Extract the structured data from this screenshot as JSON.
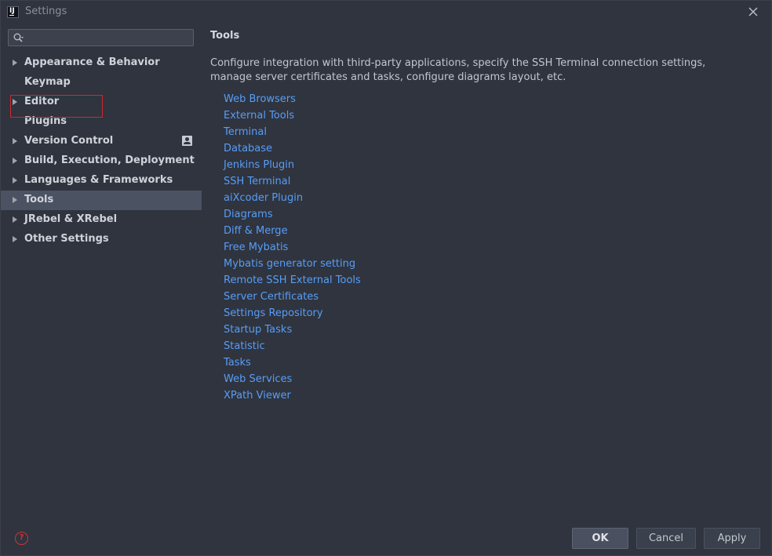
{
  "window": {
    "title": "Settings"
  },
  "search": {
    "value": "",
    "placeholder": ""
  },
  "sidebar": {
    "items": [
      {
        "label": "Appearance & Behavior",
        "expandable": true,
        "selected": false
      },
      {
        "label": "Keymap",
        "expandable": false,
        "selected": false,
        "highlighted": true
      },
      {
        "label": "Editor",
        "expandable": true,
        "selected": false
      },
      {
        "label": "Plugins",
        "expandable": false,
        "selected": false
      },
      {
        "label": "Version Control",
        "expandable": true,
        "selected": false,
        "badge_icon": "project-profile-icon"
      },
      {
        "label": "Build, Execution, Deployment",
        "expandable": true,
        "selected": false
      },
      {
        "label": "Languages & Frameworks",
        "expandable": true,
        "selected": false
      },
      {
        "label": "Tools",
        "expandable": true,
        "selected": true
      },
      {
        "label": "JRebel & XRebel",
        "expandable": true,
        "selected": false
      },
      {
        "label": "Other Settings",
        "expandable": true,
        "selected": false
      }
    ]
  },
  "content": {
    "title": "Tools",
    "description": "Configure integration with third-party applications, specify the SSH Terminal connection settings, manage server certificates and tasks, configure diagrams layout, etc.",
    "links": [
      "Web Browsers",
      "External Tools",
      "Terminal",
      "Database",
      "Jenkins Plugin",
      "SSH Terminal",
      "aiXcoder Plugin",
      "Diagrams",
      "Diff & Merge",
      "Free Mybatis",
      "Mybatis generator setting",
      "Remote SSH External Tools",
      "Server Certificates",
      "Settings Repository",
      "Startup Tasks",
      "Statistic",
      "Tasks",
      "Web Services",
      "XPath Viewer"
    ]
  },
  "footer": {
    "help_icon": "help-icon",
    "ok_label": "OK",
    "cancel_label": "Cancel",
    "apply_label": "Apply"
  },
  "colors": {
    "background": "#2f343f",
    "selection": "#4b5262",
    "link": "#589df6",
    "highlight_border": "#d0282d"
  }
}
